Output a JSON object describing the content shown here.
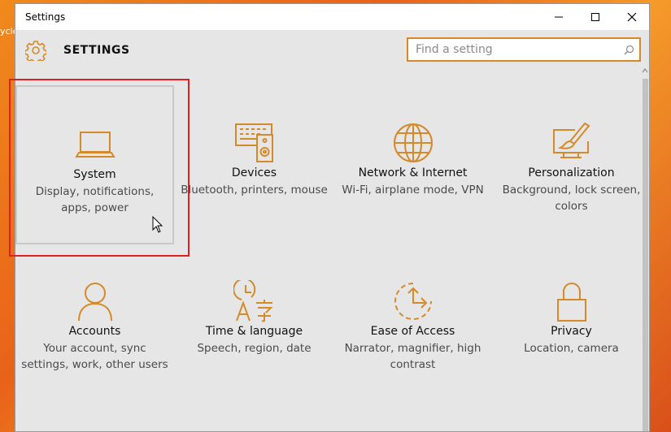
{
  "desktop": {
    "icon_label": "ycle"
  },
  "window": {
    "title": "Settings",
    "controls": {
      "minimize": "minimize",
      "maximize": "maximize",
      "close": "close"
    }
  },
  "header": {
    "title": "SETTINGS",
    "icon": "gear-icon"
  },
  "search": {
    "placeholder": "Find a setting",
    "value": "",
    "icon": "search-icon"
  },
  "accent_color": "#d48a2a",
  "highlight_color": "#e02020",
  "tiles": [
    {
      "name": "System",
      "description": "Display, notifications, apps, power",
      "icon": "laptop-icon",
      "selected": true
    },
    {
      "name": "Devices",
      "description": "Bluetooth, printers, mouse",
      "icon": "devices-icon"
    },
    {
      "name": "Network & Internet",
      "description": "Wi-Fi, airplane mode, VPN",
      "icon": "globe-icon"
    },
    {
      "name": "Personalization",
      "description": "Background, lock screen, colors",
      "icon": "paint-brush-icon"
    },
    {
      "name": "Accounts",
      "description": "Your account, sync settings, work, other users",
      "icon": "person-icon"
    },
    {
      "name": "Time & language",
      "description": "Speech, region, date",
      "icon": "time-language-icon"
    },
    {
      "name": "Ease of Access",
      "description": "Narrator, magnifier, high contrast",
      "icon": "ease-of-access-icon"
    },
    {
      "name": "Privacy",
      "description": "Location, camera",
      "icon": "lock-icon"
    }
  ]
}
